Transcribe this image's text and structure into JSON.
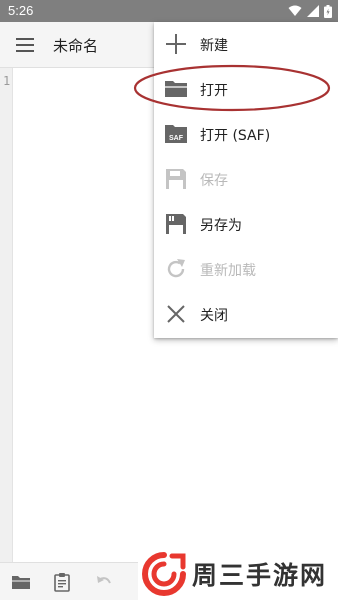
{
  "status_bar": {
    "time": "5:26",
    "icons": [
      "wifi-icon",
      "signal-icon",
      "battery-icon"
    ]
  },
  "app_bar": {
    "title": "未命名",
    "menu_icon": "hamburger-icon"
  },
  "editor": {
    "line_numbers": [
      "1"
    ]
  },
  "menu": {
    "items": [
      {
        "label": "新建",
        "icon": "plus-icon",
        "enabled": true
      },
      {
        "label": "打开",
        "icon": "folder-open-icon",
        "enabled": true,
        "highlighted": true
      },
      {
        "label": "打开 (SAF)",
        "icon": "saf-folder-icon",
        "enabled": true
      },
      {
        "label": "保存",
        "icon": "floppy-disk-icon",
        "enabled": false
      },
      {
        "label": "另存为",
        "icon": "save-as-icon",
        "enabled": true
      },
      {
        "label": "重新加载",
        "icon": "reload-icon",
        "enabled": false
      },
      {
        "label": "关闭",
        "icon": "close-icon",
        "enabled": true
      }
    ],
    "saf_badge": "SAF"
  },
  "bottom_bar": {
    "icons": [
      "folder-icon",
      "clipboard-icon",
      "undo-icon"
    ]
  },
  "watermark": {
    "text": "周三手游网"
  },
  "colors": {
    "status_bar": "#7f7f7f",
    "app_bar": "#f5f5f5",
    "icon_gray": "#666666",
    "disabled_gray": "#c4c4c4",
    "annotation_red": "#a83232",
    "watermark_red": "#e8382f"
  }
}
